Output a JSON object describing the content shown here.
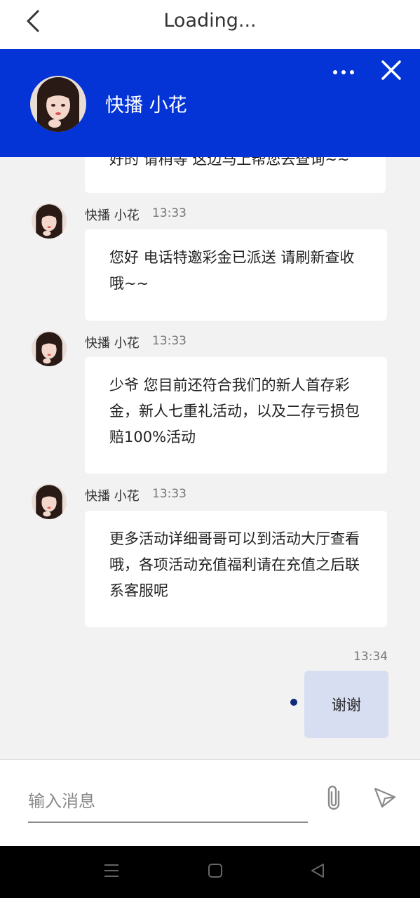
{
  "topbar": {
    "title": "Loading..."
  },
  "header": {
    "agent_name": "快播 小花"
  },
  "messages": [
    {
      "text": "好的 请稍等 这边马上帮您去查询~~"
    },
    {
      "sender": "快播 小花",
      "time": "13:33",
      "text": "您好 电话特邀彩金已派送 请刷新查收哦~~"
    },
    {
      "sender": "快播 小花",
      "time": "13:33",
      "text": "少爷 您目前还符合我们的新人首存彩金，新人七重礼活动，以及二存亏损包赔100%活动"
    },
    {
      "sender": "快播 小花",
      "time": "13:33",
      "text": "更多活动详细哥哥可以到活动大厅查看哦，各项活动充值福利请在充值之后联系客服呢"
    }
  ],
  "my_message": {
    "time": "13:34",
    "text": "谢谢"
  },
  "input": {
    "placeholder": "输入消息",
    "value": ""
  },
  "colors": {
    "header_bg": "#0434d6",
    "my_bubble": "#d8def1",
    "page_bg": "#f2f2f2",
    "read_dot": "#102a7a"
  },
  "icons": {
    "back": "chevron-left-icon",
    "more": "more-dots-icon",
    "close": "close-icon",
    "attach": "paperclip-icon",
    "send": "send-icon",
    "nav_menu": "menu-icon",
    "nav_home": "home-icon",
    "nav_back": "triangle-back-icon"
  }
}
